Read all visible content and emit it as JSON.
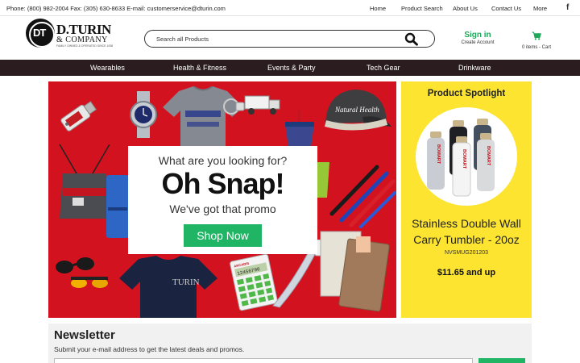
{
  "topbar": {
    "contact": "Phone: (800) 982-2004 Fax: (305) 630-8633 E-mail: customerservice@dturin.com",
    "nav": [
      "Home",
      "Product Search",
      "About Us",
      "Contact Us",
      "More"
    ]
  },
  "logo": {
    "mono": "DT",
    "name": "D.TURIN",
    "sub": "& COMPANY",
    "tag": "FAMILY OWNED & OPERATED SINCE 1938"
  },
  "search": {
    "placeholder": "Search all Products",
    "value": ""
  },
  "account": {
    "signin": "Sign in",
    "create": "Create Account"
  },
  "cart": {
    "count": "0 items - Cart"
  },
  "categories": [
    "Wearables",
    "Health & Fitness",
    "Events & Party",
    "Tech Gear",
    "Drinkware"
  ],
  "hero": {
    "question": "What are you looking for?",
    "headline": "Oh Snap!",
    "subhead": "We've got that promo",
    "button": "Shop Now",
    "shirt_text": "TURIN",
    "cap_text": "Natural Health",
    "calc_text": "ARCADIS",
    "calc_display": "12456790"
  },
  "spotlight": {
    "title": "Product Spotlight",
    "name": "Stainless Double Wall Carry Tumbler - 20oz",
    "sku": "NVSMUG201203",
    "price": "$11.65 and up",
    "brand": "BOMART"
  },
  "newsletter": {
    "title": "Newsletter",
    "text": "Submit your e-mail address to get the latest deals and promos."
  },
  "colors": {
    "accent": "#1fb564",
    "hero_bg": "#d3121f",
    "spotlight_bg": "#fde431",
    "catbar": "#2a1c1f"
  }
}
